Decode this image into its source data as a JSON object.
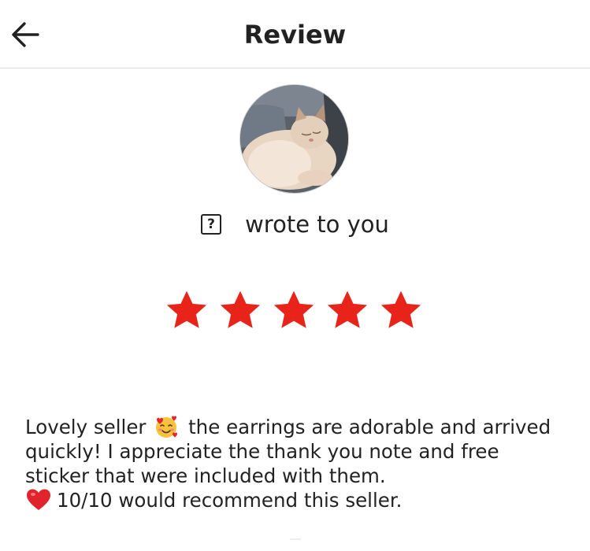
{
  "header": {
    "title": "Review",
    "back_icon": "arrow-left-icon"
  },
  "reviewer": {
    "avatar_description": "cat-avatar",
    "unknown_name_glyph": "?",
    "wrote_text": "wrote to you"
  },
  "rating": {
    "stars": 5,
    "max": 5,
    "color": "#E8231A"
  },
  "review": {
    "part1": "Lovely seller",
    "emoji": "smiling-face-with-hearts-icon",
    "part2": "the earrings are adorable and arrived quickly! I appreciate the thank you note and free sticker that were included with them.",
    "heart": "red-heart-icon",
    "part3": "10/10 would recommend this seller."
  },
  "colors": {
    "text": "#222222",
    "divider": "#d9d9d9",
    "star": "#E8231A"
  }
}
